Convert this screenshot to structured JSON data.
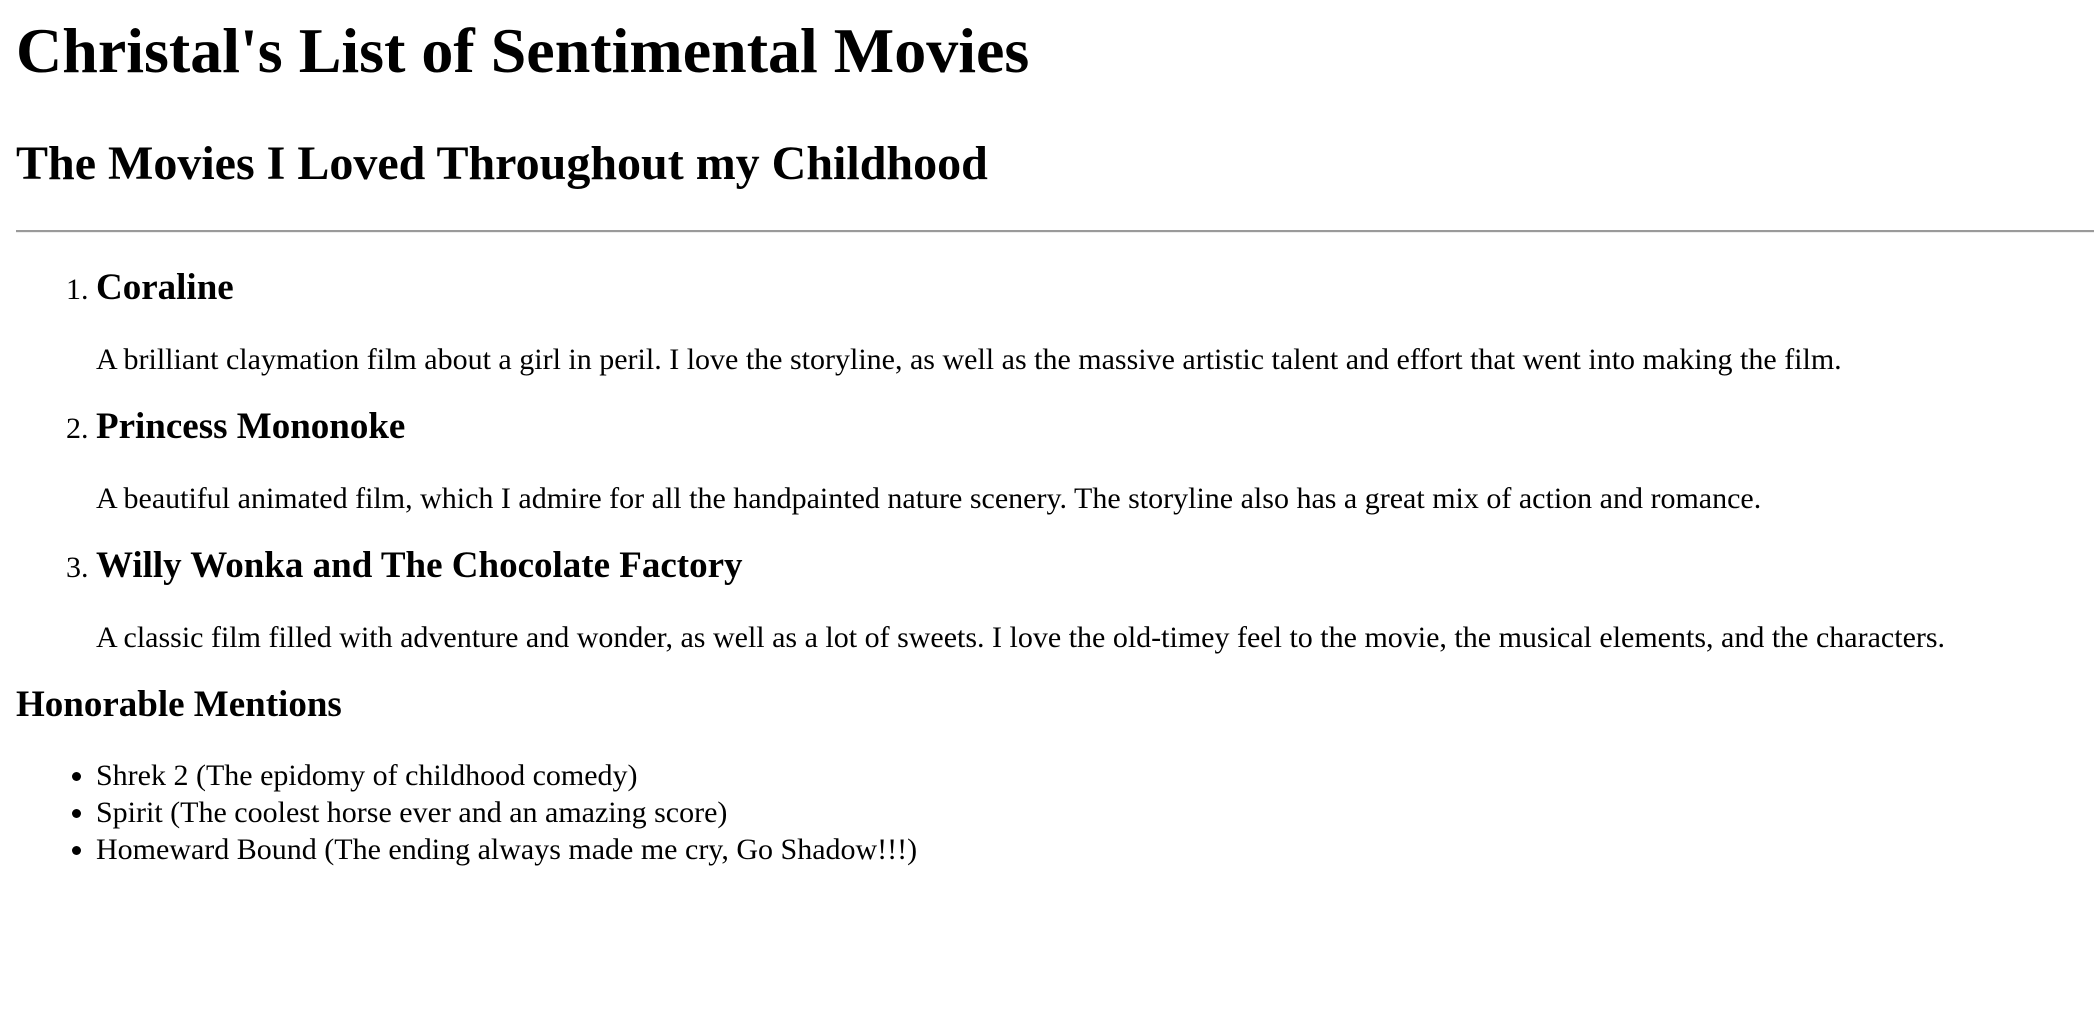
{
  "page": {
    "title": "Christal's List of Sentimental Movies",
    "subtitle": "The Movies I Loved Throughout my Childhood"
  },
  "movies": [
    {
      "title": "Coraline",
      "description": "A brilliant claymation film about a girl in peril. I love the storyline, as well as the massive artistic talent and effort that went into making the film."
    },
    {
      "title": "Princess Mononoke",
      "description": "A beautiful animated film, which I admire for all the handpainted nature scenery. The storyline also has a great mix of action and romance."
    },
    {
      "title": "Willy Wonka and The Chocolate Factory",
      "description": "A classic film filled with adventure and wonder, as well as a lot of sweets. I love the old-timey feel to the movie, the musical elements, and the characters."
    }
  ],
  "honorable": {
    "heading": "Honorable Mentions",
    "items": [
      "Shrek 2 (The epidomy of childhood comedy)",
      "Spirit (The coolest horse ever and an amazing score)",
      "Homeward Bound (The ending always made me cry, Go Shadow!!!)"
    ]
  }
}
